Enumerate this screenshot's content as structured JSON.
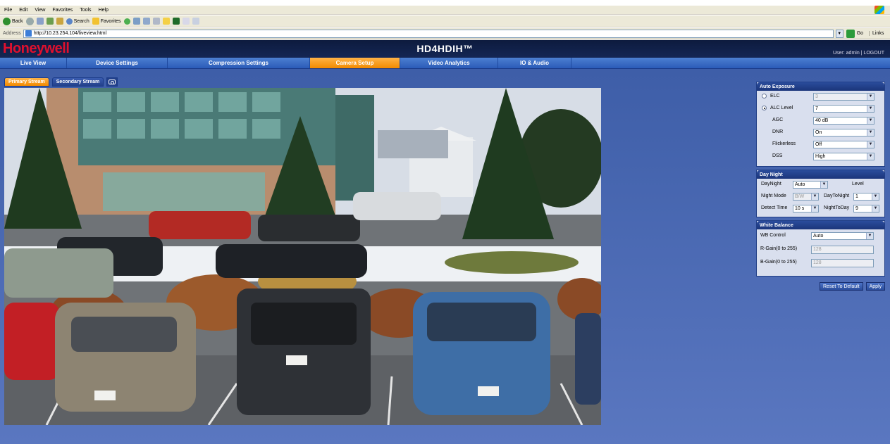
{
  "browser": {
    "menu": [
      "File",
      "Edit",
      "View",
      "Favorites",
      "Tools",
      "Help"
    ],
    "toolbar": {
      "back": "Back",
      "search": "Search",
      "favorites": "Favorites"
    },
    "address_label": "Address",
    "url": "http://10.23.254.104/liveview.html",
    "go_label": "Go",
    "links_label": "Links"
  },
  "header": {
    "logo": "Honeywell",
    "title": "HD4HDIH™",
    "user_info": "User: admin | LOGOUT"
  },
  "nav": {
    "tabs": [
      {
        "label": "Live View",
        "active": false
      },
      {
        "label": "Device Settings",
        "active": false
      },
      {
        "label": "Compression Settings",
        "active": false
      },
      {
        "label": "Camera Setup",
        "active": true
      },
      {
        "label": "Video Analytics",
        "active": false
      },
      {
        "label": "IO & Audio",
        "active": false
      }
    ]
  },
  "stream_tabs": {
    "primary": "Primary Stream",
    "secondary": "Secondary Stream"
  },
  "auto_exposure": {
    "title": "Auto Exposure",
    "elc_label": "ELC",
    "elc_value": "3",
    "alc_label": "ALC Level",
    "alc_value": "7",
    "agc_label": "AGC",
    "agc_value": "40 dB",
    "dnr_label": "DNR",
    "dnr_value": "On",
    "flickerless_label": "Flickerless",
    "flickerless_value": "Off",
    "dss_label": "DSS",
    "dss_value": "High"
  },
  "day_night": {
    "title": "Day Night",
    "daynight_label": "DayNight",
    "daynight_value": "Auto",
    "level_label": "Level",
    "night_mode_label": "Night Mode",
    "night_mode_value": "B/W",
    "day_to_night_label": "DayToNight",
    "day_to_night_value": "1",
    "detect_time_label": "Detect Time",
    "detect_time_value": "10 s",
    "night_to_day_label": "NightToDay",
    "night_to_day_value": "9"
  },
  "white_balance": {
    "title": "White Balance",
    "wb_control_label": "WB Control",
    "wb_control_value": "Auto",
    "r_gain_label": "R-Gain(0 to 255)",
    "r_gain_value": "128",
    "b_gain_label": "B-Gain(0 to 255)",
    "b_gain_value": "128"
  },
  "buttons": {
    "reset": "Reset To Default",
    "apply": "Apply"
  }
}
